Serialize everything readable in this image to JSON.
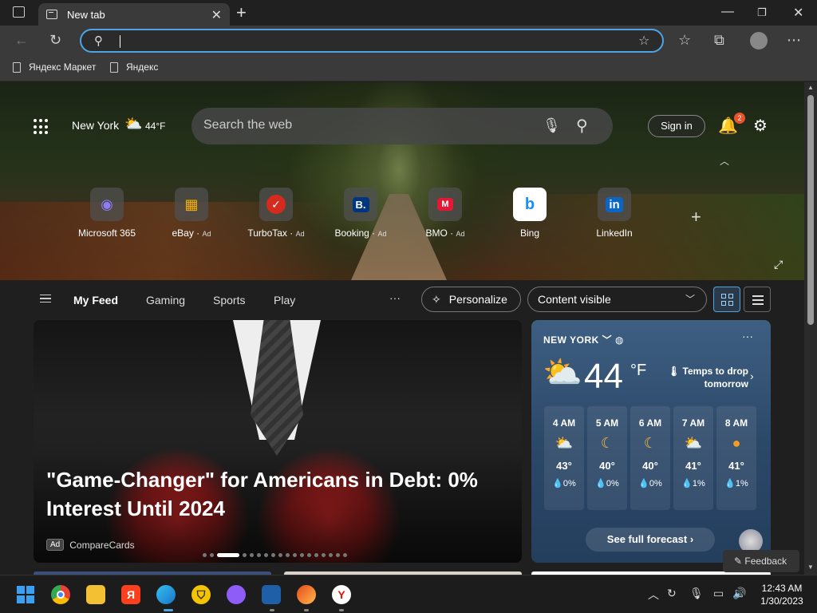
{
  "browser": {
    "tab_title": "New tab",
    "address_value": "",
    "bookmarks": [
      "Яндекс Маркет",
      "Яндекс"
    ]
  },
  "header": {
    "location": "New York",
    "temp": "44°F",
    "search_placeholder": "Search the web",
    "signin_label": "Sign in",
    "notification_count": "2"
  },
  "quick_links": [
    {
      "label": "Microsoft 365",
      "ad": "",
      "icon": "microsoft-365-icon",
      "glyph": "◉",
      "color": "#7b6cf6"
    },
    {
      "label": "eBay",
      "ad": "Ad",
      "icon": "ebay-icon",
      "glyph": "▦",
      "color": "#e53238"
    },
    {
      "label": "TurboTax",
      "ad": "Ad",
      "icon": "turbotax-icon",
      "glyph": "✓",
      "color": "#d52b1e"
    },
    {
      "label": "Booking",
      "ad": "Ad",
      "icon": "booking-icon",
      "glyph": "B.",
      "color": "#003580"
    },
    {
      "label": "BMO",
      "ad": "Ad",
      "icon": "bmo-icon",
      "glyph": "M",
      "color": "#0079c1"
    },
    {
      "label": "Bing",
      "ad": "",
      "icon": "bing-icon",
      "glyph": "b",
      "color": "#1a8cff"
    },
    {
      "label": "LinkedIn",
      "ad": "",
      "icon": "linkedin-icon",
      "glyph": "in",
      "color": "#0a66c2"
    }
  ],
  "feed_nav": {
    "items": [
      "My Feed",
      "Gaming",
      "Sports",
      "Play"
    ],
    "more": "···",
    "personalize": "Personalize",
    "content_visibility": "Content visible"
  },
  "main_card": {
    "headline": "\"Game-Changer\" for Americans in Debt: 0% Interest Until 2024",
    "ad_tag": "Ad",
    "source": "CompareCards"
  },
  "weather": {
    "city": "NEW YORK",
    "temp": "44",
    "unit": "°F",
    "note": "Temps to drop tomorrow",
    "hours": [
      {
        "time": "4 AM",
        "icon": "partly-cloudy-night-icon",
        "glyph": "☁",
        "temp": "43°",
        "precip": "0%"
      },
      {
        "time": "5 AM",
        "icon": "moon-icon",
        "glyph": "☾",
        "temp": "40°",
        "precip": "0%"
      },
      {
        "time": "6 AM",
        "icon": "moon-icon",
        "glyph": "☾",
        "temp": "40°",
        "precip": "0%"
      },
      {
        "time": "7 AM",
        "icon": "partly-cloudy-night-icon",
        "glyph": "☁",
        "temp": "41°",
        "precip": "1%"
      },
      {
        "time": "8 AM",
        "icon": "sun-icon",
        "glyph": "●",
        "temp": "41°",
        "precip": "1%"
      }
    ],
    "forecast_button": "See full forecast"
  },
  "feedback": "Feedback",
  "taskbar": {
    "time": "12:43 AM",
    "date": "1/30/2023"
  },
  "colors": {
    "accent": "#4ea5e6",
    "badge": "#e9522b",
    "weather_bg": "#2c4869"
  }
}
